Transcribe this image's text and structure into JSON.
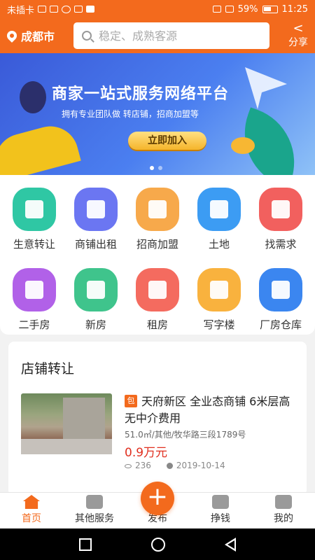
{
  "status_bar": {
    "carrier": "未插卡",
    "battery": "59%",
    "time": "11:25"
  },
  "header": {
    "city": "成都市",
    "search_placeholder": "稳定、成熟客源",
    "share_label": "分享"
  },
  "banner": {
    "title": "商家一站式服务网络平台",
    "subtitle": "拥有专业团队做 转店铺，招商加盟等",
    "button_label": "立即加入",
    "active_slide": 1,
    "slide_count": 2
  },
  "categories": [
    {
      "label": "生意转让",
      "color": "#2fc7a4",
      "icon": "transfer-icon"
    },
    {
      "label": "商铺出租",
      "color": "#6b76f2",
      "icon": "door-icon"
    },
    {
      "label": "招商加盟",
      "color": "#f7a94b",
      "icon": "handshake-icon"
    },
    {
      "label": "土地",
      "color": "#3c9cf3",
      "icon": "land-icon"
    },
    {
      "label": "找需求",
      "color": "#f2605e",
      "icon": "document-icon"
    },
    {
      "label": "二手房",
      "color": "#b161e8",
      "icon": "house-icon"
    },
    {
      "label": "新房",
      "color": "#3fc48c",
      "icon": "building-icon"
    },
    {
      "label": "租房",
      "color": "#f46b5f",
      "icon": "rent-building-icon"
    },
    {
      "label": "写字楼",
      "color": "#f9b23e",
      "icon": "office-icon"
    },
    {
      "label": "厂房仓库",
      "color": "#3b86f0",
      "icon": "factory-icon"
    }
  ],
  "shop_section": {
    "title": "店铺转让",
    "listing": {
      "badge": "包",
      "title": "天府新区 全业态商铺 6米层高 无中介费用",
      "meta": "51.0㎡/其他/牧华路三段1789号",
      "price": "0.9万元",
      "views": "236",
      "date": "2019-10-14"
    }
  },
  "bottom_nav": {
    "items": [
      {
        "label": "首页",
        "icon": "home-icon"
      },
      {
        "label": "其他服务",
        "icon": "grid-icon"
      },
      {
        "label": "发布",
        "icon": "plus-icon"
      },
      {
        "label": "挣钱",
        "icon": "money-bag-icon"
      },
      {
        "label": "我的",
        "icon": "user-icon"
      }
    ],
    "publish_symbol": "+"
  },
  "colors": {
    "brand": "#f36a1d",
    "price": "#e02f1f"
  }
}
